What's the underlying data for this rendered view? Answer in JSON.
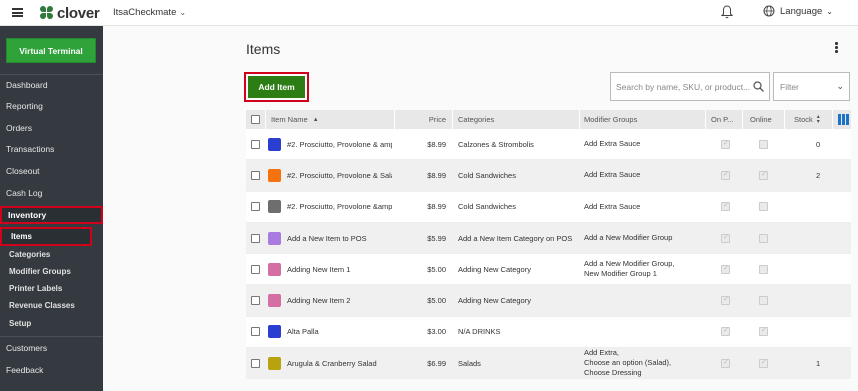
{
  "topbar": {
    "logo_text": "clover",
    "merchant_name": "ItsaCheckmate",
    "language_label": "Language"
  },
  "sidebar": {
    "virtual_terminal_label": "Virtual Terminal",
    "items": [
      {
        "label": "Dashboard"
      },
      {
        "label": "Reporting"
      },
      {
        "label": "Orders"
      },
      {
        "label": "Transactions"
      },
      {
        "label": "Closeout"
      },
      {
        "label": "Cash Log"
      },
      {
        "label": "Inventory"
      },
      {
        "label": "Items"
      },
      {
        "label": "Categories"
      },
      {
        "label": "Modifier Groups"
      },
      {
        "label": "Printer Labels"
      },
      {
        "label": "Revenue Classes"
      },
      {
        "label": "Setup"
      },
      {
        "label": "Customers"
      },
      {
        "label": "Feedback"
      }
    ]
  },
  "main": {
    "title": "Items",
    "add_item_label": "Add Item",
    "search_placeholder": "Search by name, SKU, or product...",
    "filter_label": "Filter"
  },
  "table": {
    "headers": {
      "name": "Item Name",
      "price": "Price",
      "categories": "Categories",
      "modifier_groups": "Modifier Groups",
      "on_pos": "On P...",
      "online": "Online",
      "stock": "Stock"
    },
    "rows": [
      {
        "color": "#2a3fd1",
        "name": "#2. Prosciutto, Provolone & amp",
        "price": "$8.99",
        "category": "Calzones & Strombolis",
        "modifiers": "Add Extra Sauce",
        "modifiers2": "",
        "modifiers3": "",
        "on_pos": true,
        "online": false,
        "stock": "0"
      },
      {
        "color": "#f5720f",
        "name": "#2. Prosciutto, Provolone & Sala",
        "price": "$8.99",
        "category": "Cold Sandwiches",
        "modifiers": "Add Extra Sauce",
        "modifiers2": "",
        "modifiers3": "",
        "on_pos": true,
        "online": true,
        "stock": "2"
      },
      {
        "color": "#6e6e6e",
        "name": "#2. Prosciutto, Provolone &amp",
        "price": "$8.99",
        "category": "Cold Sandwiches",
        "modifiers": "Add Extra Sauce",
        "modifiers2": "",
        "modifiers3": "",
        "on_pos": true,
        "online": false,
        "stock": ""
      },
      {
        "color": "#a97be0",
        "name": "Add a New Item to POS",
        "price": "$5.99",
        "category": "Add a New Item Category on POS",
        "modifiers": "Add a New Modifier Group",
        "modifiers2": "",
        "modifiers3": "",
        "on_pos": true,
        "online": false,
        "stock": ""
      },
      {
        "color": "#d46ea3",
        "name": "Adding New Item 1",
        "price": "$5.00",
        "category": "Adding New Category",
        "modifiers": "Add a New Modifier Group,",
        "modifiers2": "New Modifier Group 1",
        "modifiers3": "",
        "on_pos": true,
        "online": false,
        "stock": ""
      },
      {
        "color": "#d46ea3",
        "name": "Adding New Item 2",
        "price": "$5.00",
        "category": "Adding New Category",
        "modifiers": "",
        "modifiers2": "",
        "modifiers3": "",
        "on_pos": true,
        "online": false,
        "stock": ""
      },
      {
        "color": "#2a3fd1",
        "name": "Alta Palla",
        "price": "$3.00",
        "category": "N/A DRINKS",
        "modifiers": "",
        "modifiers2": "",
        "modifiers3": "",
        "on_pos": true,
        "online": true,
        "stock": ""
      },
      {
        "color": "#b8a20e",
        "name": "Arugula & Cranberry Salad",
        "price": "$6.99",
        "category": "Salads",
        "modifiers": "Add Extra,",
        "modifiers2": "Choose an option (Salad),",
        "modifiers3": "Choose Dressing",
        "on_pos": true,
        "online": true,
        "stock": "1"
      }
    ]
  }
}
